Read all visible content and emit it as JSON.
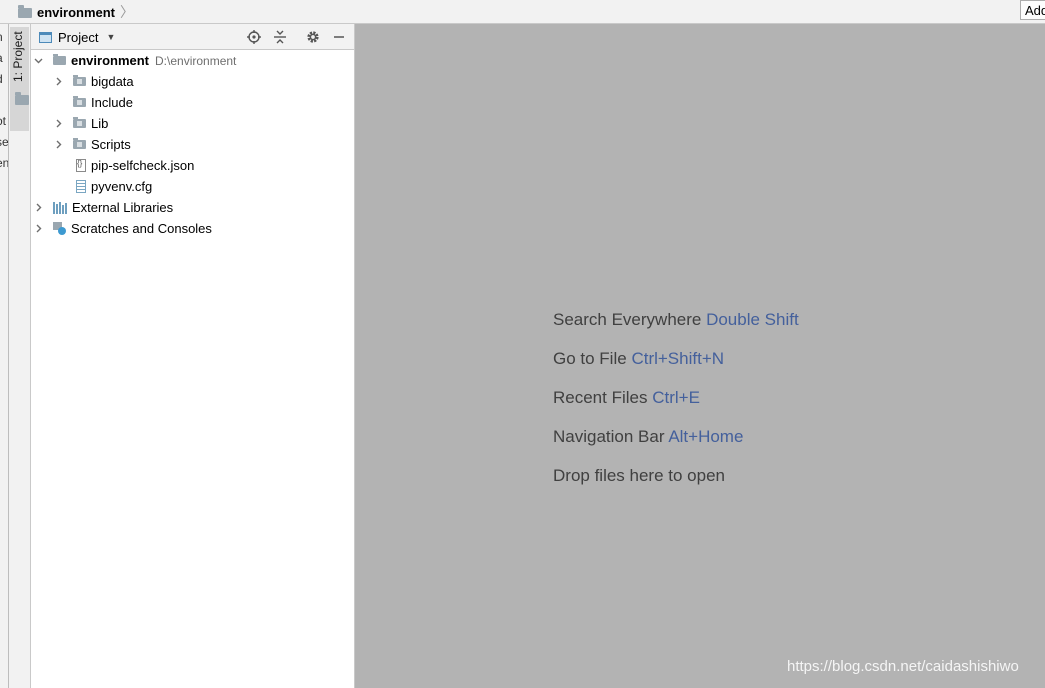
{
  "navbar": {
    "crumb": "environment",
    "separator": "〉",
    "add_button": "Add"
  },
  "left_cut_fragments": [
    "n",
    "a",
    "d",
    "ot",
    "se",
    "en"
  ],
  "stripe": {
    "tool_label": "1: Project"
  },
  "project_panel": {
    "title": "Project",
    "tree": [
      {
        "label": "environment",
        "hint": "D:\\environment",
        "bold": true,
        "expanded": true,
        "icon": "folder-icon"
      },
      {
        "label": "bigdata",
        "expandable": true,
        "icon": "folder-icon"
      },
      {
        "label": "Include",
        "expandable": false,
        "icon": "folder-icon"
      },
      {
        "label": "Lib",
        "expandable": true,
        "icon": "folder-icon"
      },
      {
        "label": "Scripts",
        "expandable": true,
        "icon": "folder-icon"
      },
      {
        "label": "pip-selfcheck.json",
        "icon": "json-file-icon"
      },
      {
        "label": "pyvenv.cfg",
        "icon": "config-file-icon"
      },
      {
        "label": "External Libraries",
        "expandable": true,
        "icon": "libraries-icon"
      },
      {
        "label": "Scratches and Consoles",
        "expandable": true,
        "icon": "scratches-icon"
      }
    ]
  },
  "editor": {
    "hints": [
      {
        "text": "Search Everywhere",
        "shortcut": "Double Shift"
      },
      {
        "text": "Go to File",
        "shortcut": "Ctrl+Shift+N"
      },
      {
        "text": "Recent Files",
        "shortcut": "Ctrl+E"
      },
      {
        "text": "Navigation Bar",
        "shortcut": "Alt+Home"
      },
      {
        "text": "Drop files here to open",
        "shortcut": ""
      }
    ],
    "watermark": "https://blog.csdn.net/caidashishiwo"
  },
  "colors": {
    "editor_bg": "#b3b3b3",
    "shortcut": "#44609c",
    "hint_text": "#404040",
    "folder": "#9aa7b0"
  }
}
